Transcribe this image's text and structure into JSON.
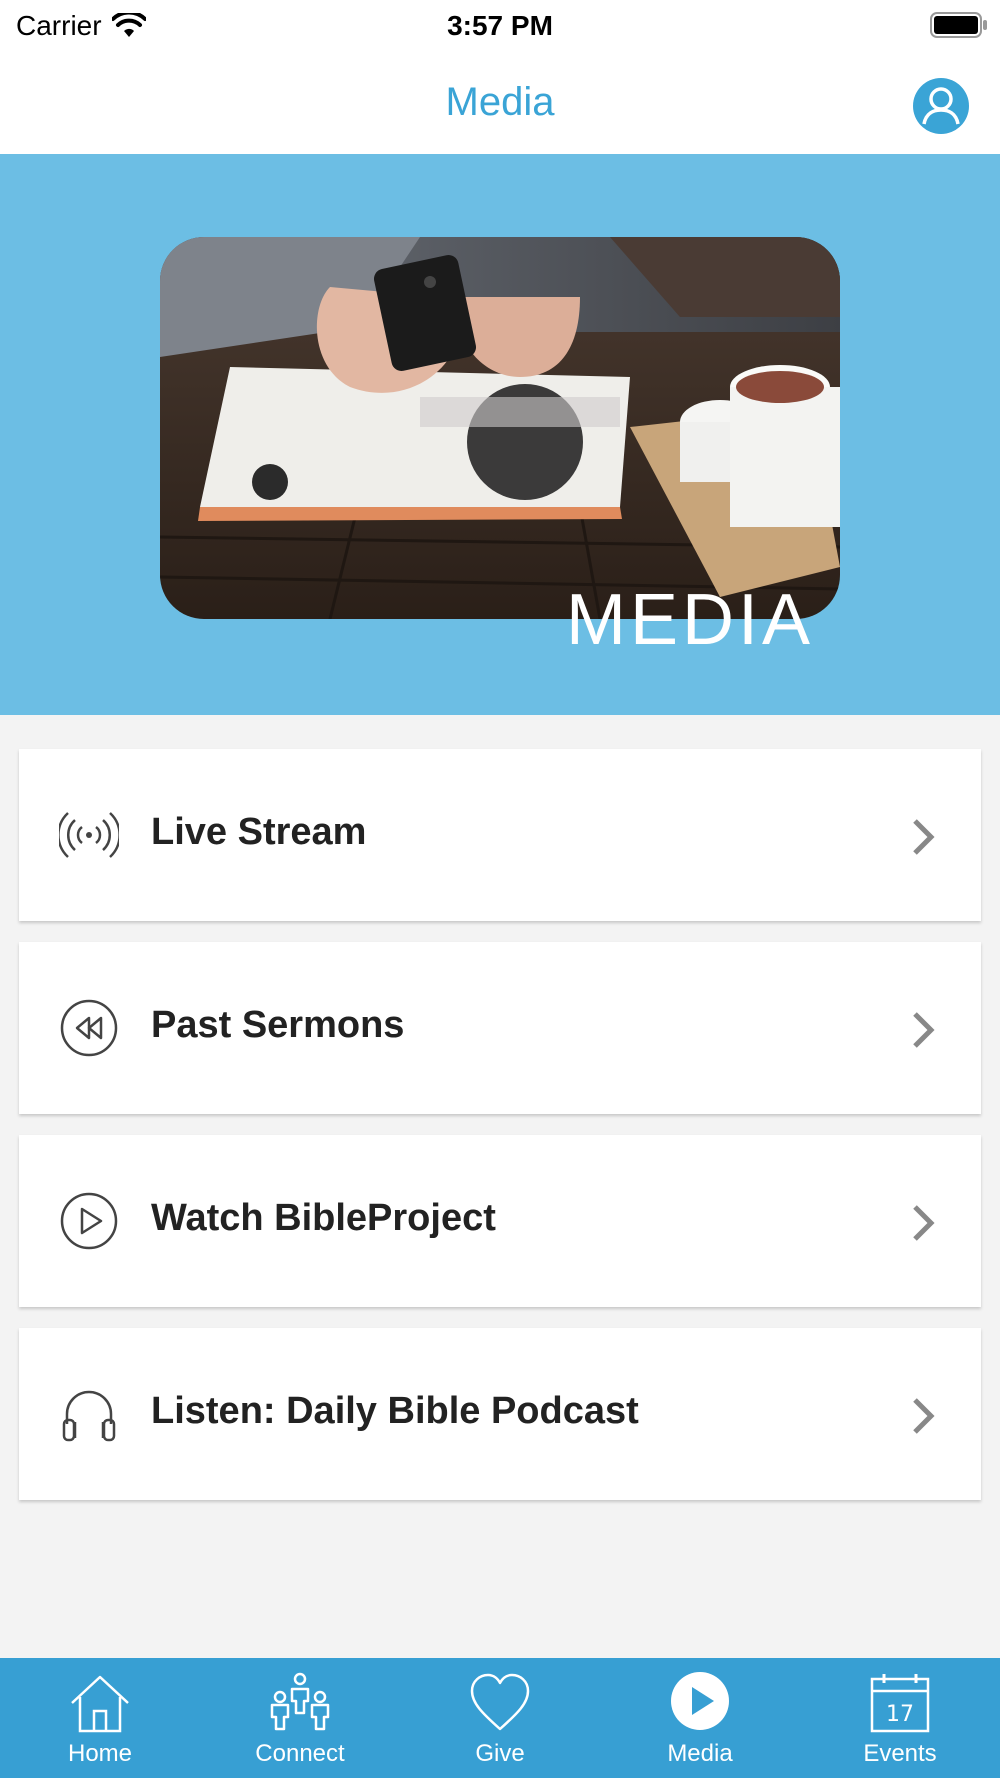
{
  "status_bar": {
    "carrier": "Carrier",
    "time": "3:57 PM"
  },
  "nav": {
    "title": "Media",
    "profile_icon": "user-circle-icon"
  },
  "hero": {
    "caption": "MEDIA",
    "image_subject": "hands holding phone over magazine with coffee cups"
  },
  "menu": {
    "items": [
      {
        "label": "Live Stream",
        "icon": "broadcast-icon"
      },
      {
        "label": "Past Sermons",
        "icon": "rewind-icon"
      },
      {
        "label": "Watch BibleProject",
        "icon": "play-circle-icon"
      },
      {
        "label": "Listen: Daily Bible Podcast",
        "icon": "headphones-icon"
      }
    ]
  },
  "tab_bar": {
    "tabs": [
      {
        "label": "Home",
        "icon": "home-icon"
      },
      {
        "label": "Connect",
        "icon": "people-icon"
      },
      {
        "label": "Give",
        "icon": "heart-icon"
      },
      {
        "label": "Media",
        "icon": "play-icon",
        "active": true
      },
      {
        "label": "Events",
        "icon": "calendar-icon",
        "day": "17"
      }
    ]
  },
  "colors": {
    "accent": "#3aa4d6",
    "hero_bg": "#6cbee4",
    "tab_bar_bg": "#379fd3",
    "page_bg": "#f3f3f3"
  }
}
